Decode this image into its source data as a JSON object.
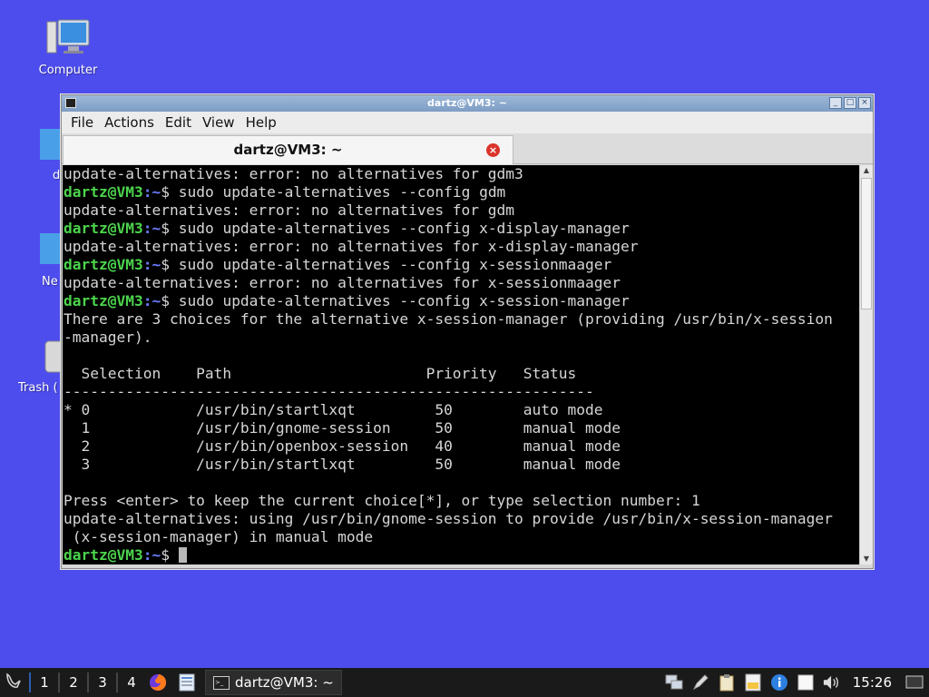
{
  "desktop": {
    "icons": [
      {
        "label": "Computer"
      },
      {
        "label": "d"
      },
      {
        "label": "Ne"
      },
      {
        "label": "Trash ("
      }
    ]
  },
  "window": {
    "title": "dartz@VM3: ~",
    "menu": [
      "File",
      "Actions",
      "Edit",
      "View",
      "Help"
    ],
    "tab_title": "dartz@VM3: ~",
    "controls": {
      "minimize": "_",
      "maximize": "□",
      "close": "×"
    }
  },
  "terminal": {
    "prompt_user": "dartz@VM3",
    "prompt_path": ":~",
    "prompt_symbol": "$",
    "lines": [
      {
        "type": "out",
        "text": "update-alternatives: error: no alternatives for gdm3"
      },
      {
        "type": "cmd",
        "text": " sudo update-alternatives --config gdm"
      },
      {
        "type": "out",
        "text": "update-alternatives: error: no alternatives for gdm"
      },
      {
        "type": "cmd",
        "text": " sudo update-alternatives --config x-display-manager"
      },
      {
        "type": "out",
        "text": "update-alternatives: error: no alternatives for x-display-manager"
      },
      {
        "type": "cmd",
        "text": " sudo update-alternatives --config x-sessionmaager"
      },
      {
        "type": "out",
        "text": "update-alternatives: error: no alternatives for x-sessionmaager"
      },
      {
        "type": "cmd",
        "text": " sudo update-alternatives --config x-session-manager"
      },
      {
        "type": "out",
        "text": "There are 3 choices for the alternative x-session-manager (providing /usr/bin/x-session"
      },
      {
        "type": "out",
        "text": "-manager)."
      },
      {
        "type": "out",
        "text": ""
      },
      {
        "type": "out",
        "text": "  Selection    Path                      Priority   Status"
      },
      {
        "type": "out",
        "text": "------------------------------------------------------------"
      },
      {
        "type": "out",
        "text": "* 0            /usr/bin/startlxqt         50        auto mode"
      },
      {
        "type": "out",
        "text": "  1            /usr/bin/gnome-session     50        manual mode"
      },
      {
        "type": "out",
        "text": "  2            /usr/bin/openbox-session   40        manual mode"
      },
      {
        "type": "out",
        "text": "  3            /usr/bin/startlxqt         50        manual mode"
      },
      {
        "type": "out",
        "text": ""
      },
      {
        "type": "out",
        "text": "Press <enter> to keep the current choice[*], or type selection number: 1"
      },
      {
        "type": "out",
        "text": "update-alternatives: using /usr/bin/gnome-session to provide /usr/bin/x-session-manager"
      },
      {
        "type": "out",
        "text": " (x-session-manager) in manual mode"
      },
      {
        "type": "prompt",
        "text": " "
      }
    ]
  },
  "taskbar": {
    "desktops": [
      "1",
      "2",
      "3",
      "4"
    ],
    "task_label": "dartz@VM3: ~",
    "clock": "15:26",
    "tray_icons": [
      "network-icon",
      "pen-icon",
      "clipboard-icon",
      "update-icon",
      "info-icon",
      "notes-icon",
      "volume-icon"
    ]
  },
  "colors": {
    "desktop": "#4d4dee",
    "prompt_user": "#4cd44c",
    "prompt_path": "#6b7dff",
    "terminal_bg": "#000000",
    "terminal_fg": "#d6d6d6"
  }
}
